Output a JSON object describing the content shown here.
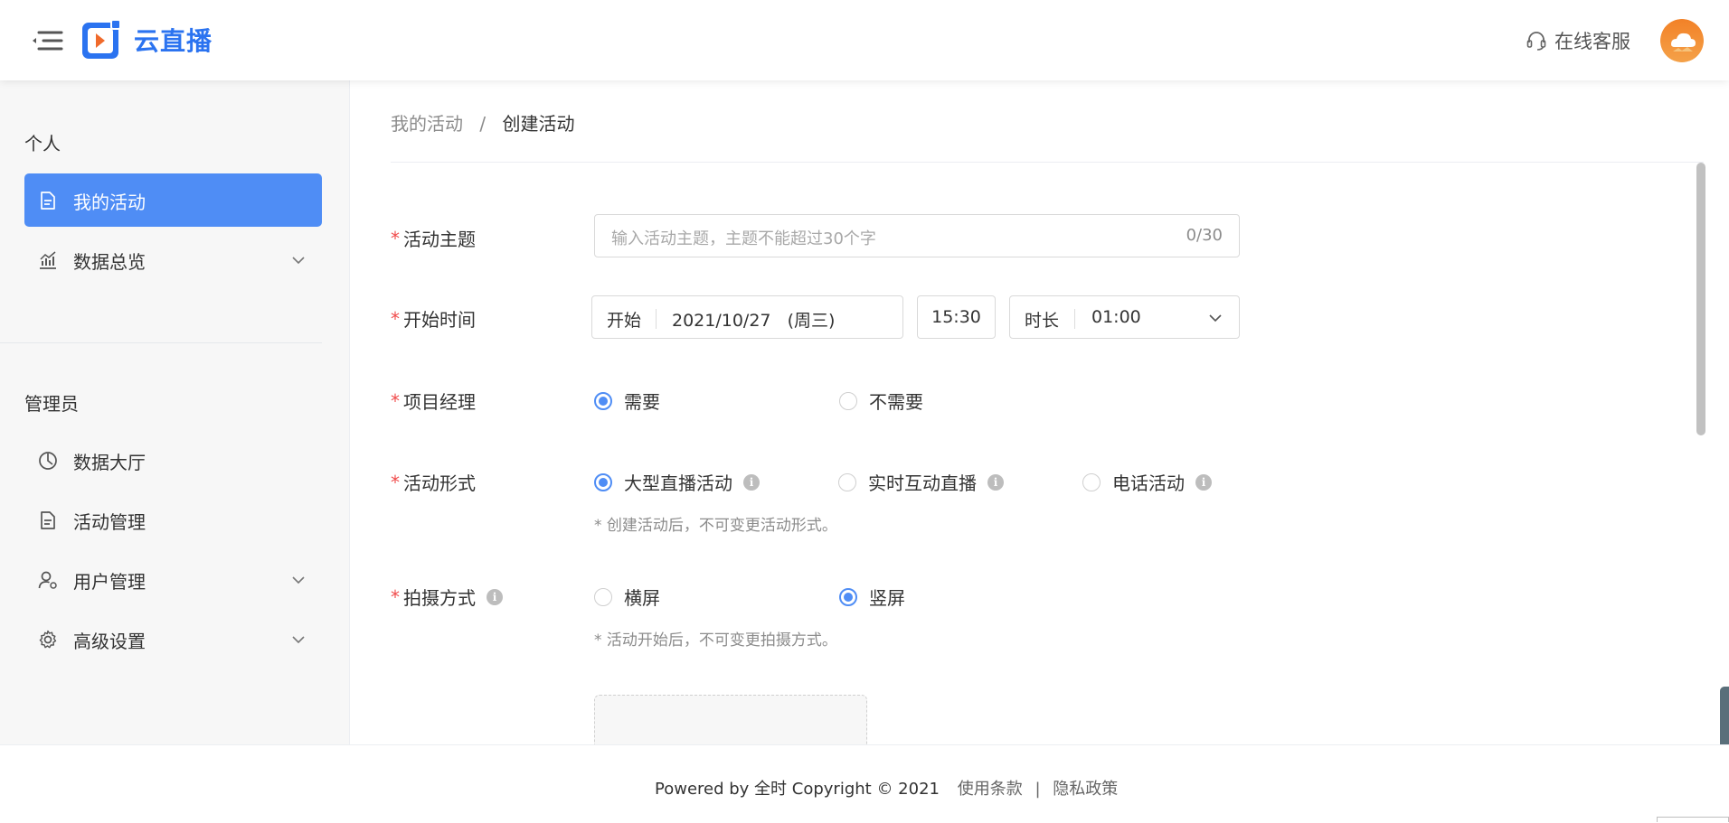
{
  "app": {
    "name": "云直播"
  },
  "header": {
    "support_label": "在线客服"
  },
  "sidebar": {
    "personal_title": "个人",
    "personal_items": [
      {
        "label": "我的活动",
        "icon": "document-icon",
        "active": true
      },
      {
        "label": "数据总览",
        "icon": "chart-icon",
        "expandable": true
      }
    ],
    "admin_title": "管理员",
    "admin_items": [
      {
        "label": "数据大厅",
        "icon": "pie-chart-icon"
      },
      {
        "label": "活动管理",
        "icon": "document-icon"
      },
      {
        "label": "用户管理",
        "icon": "user-settings-icon",
        "expandable": true
      },
      {
        "label": "高级设置",
        "icon": "gear-icon",
        "expandable": true
      }
    ]
  },
  "breadcrumb": {
    "parent": "我的活动",
    "separator": "/",
    "current": "创建活动"
  },
  "form": {
    "theme": {
      "label": "活动主题",
      "placeholder": "输入活动主题，主题不能超过30个字",
      "count": "0/30"
    },
    "start_time": {
      "label": "开始时间",
      "start_label": "开始",
      "date": "2021/10/27   (周三)",
      "time": "15:30",
      "duration_label": "时长",
      "duration": "01:00"
    },
    "manager": {
      "label": "项目经理",
      "options": [
        "需要",
        "不需要"
      ],
      "selected": "需要"
    },
    "format": {
      "label": "活动形式",
      "options": [
        "大型直播活动",
        "实时互动直播",
        "电话活动"
      ],
      "selected": "大型直播活动",
      "hint": "* 创建活动后，不可变更活动形式。"
    },
    "shooting": {
      "label": "拍摄方式",
      "options": [
        "横屏",
        "竖屏"
      ],
      "selected": "竖屏",
      "hint": "* 活动开始后，不可变更拍摄方式。"
    }
  },
  "footer": {
    "powered": "Powered by 全时 Copyright © 2021",
    "terms": "使用条款",
    "separator": "|",
    "privacy": "隐私政策"
  },
  "colors": {
    "primary": "#4f8df5",
    "brand": "#2b73f0",
    "required": "#f04b4b",
    "avatar": "#f08a2e"
  }
}
